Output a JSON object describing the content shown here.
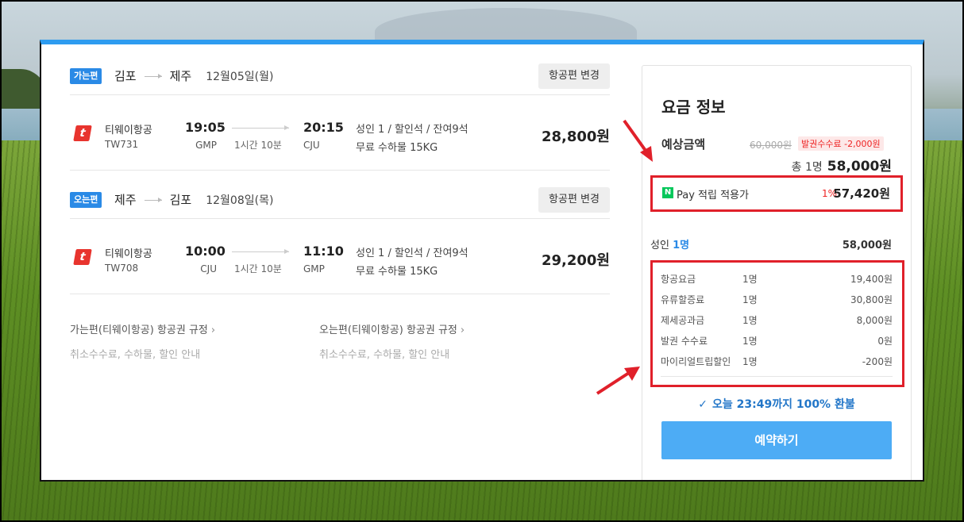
{
  "outbound": {
    "badge": "가는편",
    "from": "김포",
    "to": "제주",
    "date": "12월05일(월)",
    "change_label": "항공편 변경",
    "airline": "티웨이항공",
    "flight_no": "TW731",
    "dep_time": "19:05",
    "dep_code": "GMP",
    "duration": "1시간 10분",
    "arr_time": "20:15",
    "arr_code": "CJU",
    "seat_info": "성인 1 / 할인석 / 잔여9석",
    "baggage": "무료 수하물 15KG",
    "price": "28,800원"
  },
  "inbound": {
    "badge": "오는편",
    "from": "제주",
    "to": "김포",
    "date": "12월08일(목)",
    "change_label": "항공편 변경",
    "airline": "티웨이항공",
    "flight_no": "TW708",
    "dep_time": "10:00",
    "dep_code": "CJU",
    "duration": "1시간 10분",
    "arr_time": "11:10",
    "arr_code": "GMP",
    "seat_info": "성인 1 / 할인석 / 잔여9석",
    "baggage": "무료 수하물 15KG",
    "price": "29,200원"
  },
  "rules": {
    "outbound_title": "가는편(티웨이항공) 항공권 규정",
    "inbound_title": "오는편(티웨이항공) 항공권 규정",
    "sub": "취소수수료, 수하물, 할인 안내",
    "chevron": "›"
  },
  "fare": {
    "title": "요금 정보",
    "est_label": "예상금액",
    "orig_price": "60,000원",
    "fee_badge": "발권수수료 -2,000원",
    "total_prefix": "총 1명",
    "total_amount": "58,000원",
    "npay_icon": "N",
    "npay_label": "Pay 적립 적용가",
    "npay_pct": "1%",
    "npay_amount": "57,420원",
    "adult_label": "성인",
    "adult_count": "1명",
    "adult_amount": "58,000원",
    "breakdown": [
      {
        "name": "항공요금",
        "qty": "1명",
        "amount": "19,400원"
      },
      {
        "name": "유류할증료",
        "qty": "1명",
        "amount": "30,800원"
      },
      {
        "name": "제세공과금",
        "qty": "1명",
        "amount": "8,000원"
      },
      {
        "name": "발권 수수료",
        "qty": "1명",
        "amount": "0원"
      },
      {
        "name": "마이리얼트립할인",
        "qty": "1명",
        "amount": "-200원"
      }
    ],
    "refund": "오늘 23:49까지 100% 환불",
    "book_label": "예약하기"
  },
  "colors": {
    "accent": "#2e9cf0",
    "badge_blue": "#2a8ae6",
    "highlight_red": "#e0202a",
    "book_button": "#4dacf5",
    "npay_green": "#03c75a"
  }
}
